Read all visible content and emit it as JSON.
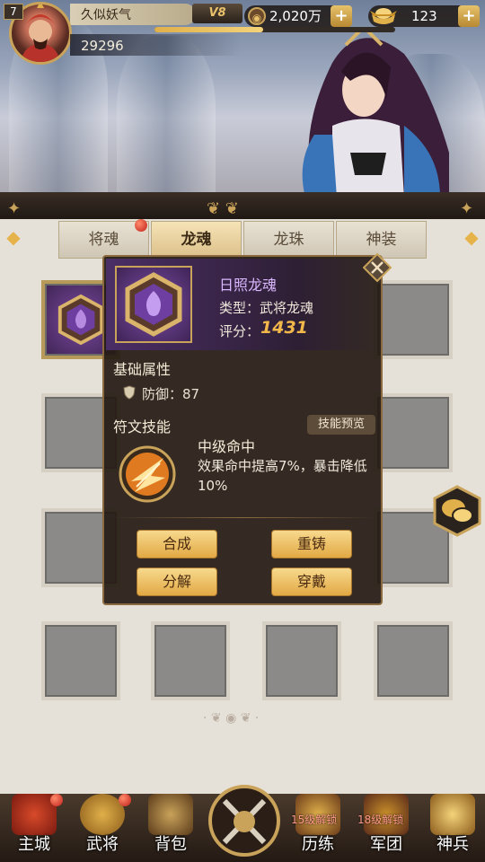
{
  "player": {
    "level": "7",
    "name": "久似妖气",
    "vip": "V8",
    "power": "29296",
    "exp_progress": 0.45
  },
  "resources": {
    "copper": "2,020万",
    "ingot": "123"
  },
  "tabs": [
    {
      "label": "将魂",
      "active": false
    },
    {
      "label": "龙魂",
      "active": true
    },
    {
      "label": "龙珠",
      "active": false
    },
    {
      "label": "神装",
      "active": false
    }
  ],
  "popup": {
    "name": "日照龙魂",
    "type": "类型：武将龙魂",
    "score_label": "评分：",
    "score": "1431",
    "base_attr_title": "基础属性",
    "defense": "防御：87",
    "rune_skill_title": "符文技能",
    "skill_preview": "技能预览",
    "skill_name": "中级命中",
    "skill_desc": "效果命中提高7%，暴击降低10%",
    "buttons": {
      "compose": "合成",
      "recast": "重铸",
      "decompose": "分解",
      "equip": "穿戴"
    }
  },
  "bottom_nav": [
    {
      "label": "主城",
      "lock": ""
    },
    {
      "label": "武将",
      "lock": ""
    },
    {
      "label": "背包",
      "lock": ""
    },
    {
      "label": "",
      "lock": ""
    },
    {
      "label": "历练",
      "lock": "15级解锁"
    },
    {
      "label": "军团",
      "lock": "18级解锁"
    },
    {
      "label": "神兵",
      "lock": ""
    }
  ],
  "colors": {
    "accent_gold": "#e2a944",
    "rune_purple": "#7b4aa0",
    "score": "#f2b84a"
  }
}
